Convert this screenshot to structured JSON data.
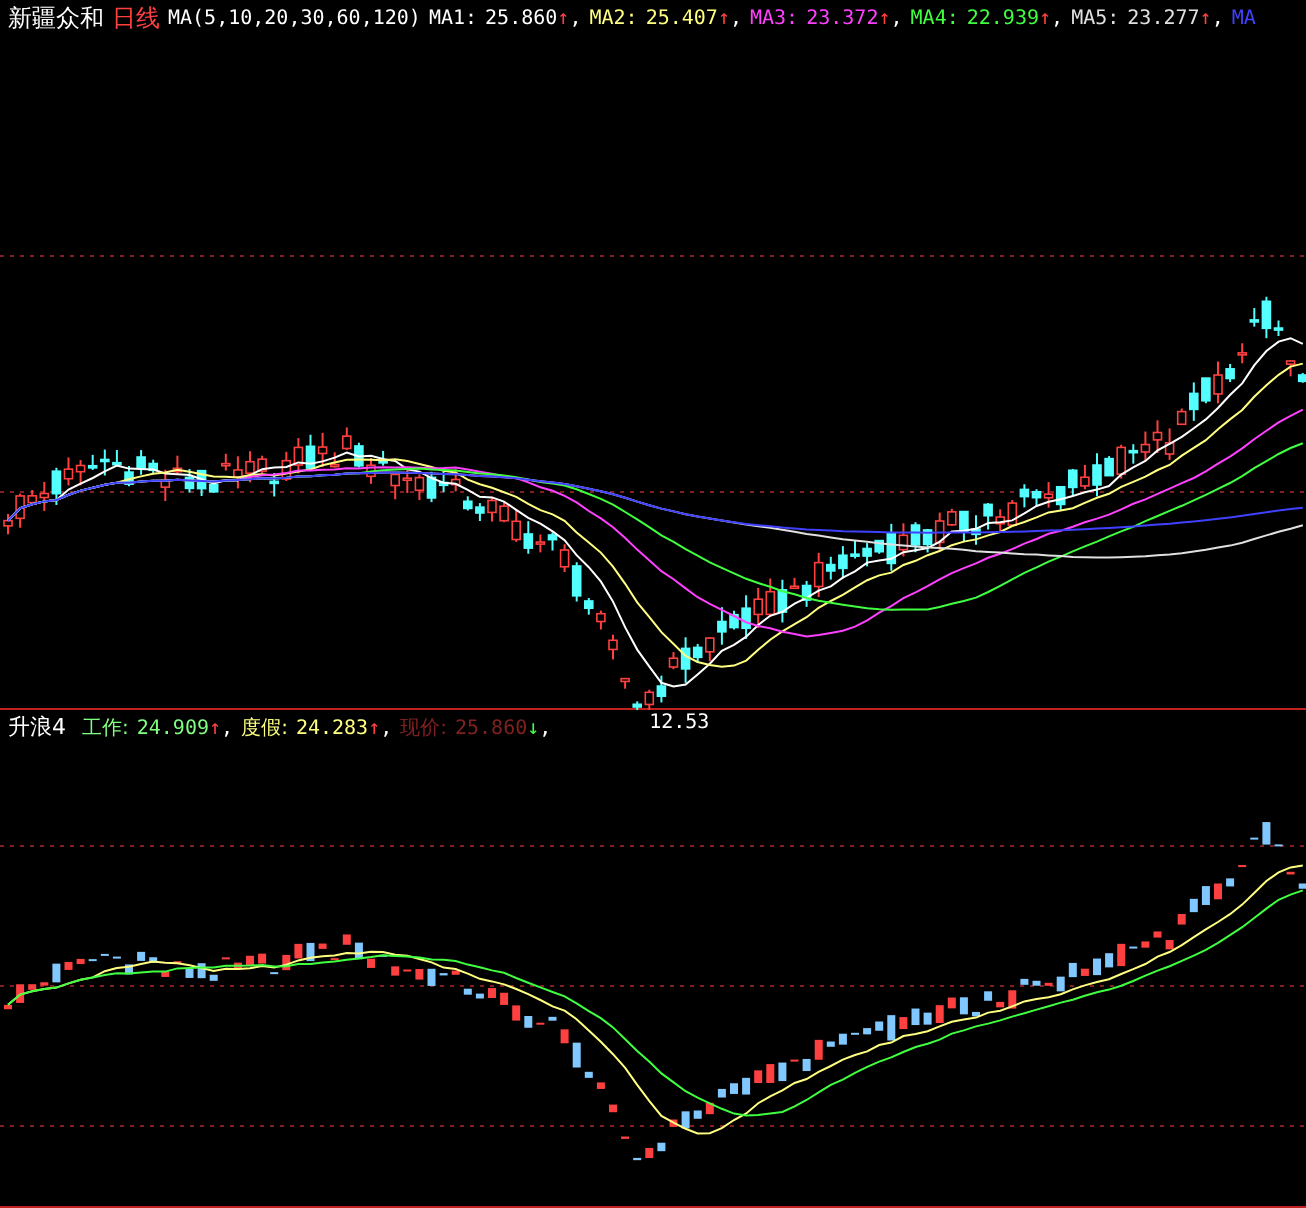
{
  "main_header": {
    "stock_name": "新疆众和",
    "period": "日线",
    "indicator": "MA(5,10,20,30,60,120)",
    "averages": [
      {
        "label": "MA1:",
        "value": "25.860",
        "arrow": "↑",
        "separator": ",",
        "color": "#ffffff"
      },
      {
        "label": "MA2:",
        "value": "25.407",
        "arrow": "↑",
        "separator": ",",
        "color": "#ffff80"
      },
      {
        "label": "MA3:",
        "value": "23.372",
        "arrow": "↑",
        "separator": ",",
        "color": "#ff40ff"
      },
      {
        "label": "MA4:",
        "value": "22.939",
        "arrow": "↑",
        "separator": ",",
        "color": "#40ff40"
      },
      {
        "label": "MA5:",
        "value": "23.277",
        "arrow": "↑",
        "separator": ",",
        "color": "#e0e0e0"
      },
      {
        "label": "MA",
        "color": "#4040ff"
      }
    ]
  },
  "price_chart": {
    "low_label": "12.53"
  },
  "indicator_header": {
    "name": "升浪4",
    "values": [
      {
        "label": "工作:",
        "value": "24.909",
        "arrow": "↑",
        "separator": ",",
        "color": "#80ff80"
      },
      {
        "label": "度假:",
        "value": "24.283",
        "arrow": "↑",
        "separator": ",",
        "color": "#ffff80"
      },
      {
        "label": "现价:",
        "value": "25.860",
        "arrow": "↓",
        "separator": ",",
        "color": "#802020"
      }
    ]
  }
}
